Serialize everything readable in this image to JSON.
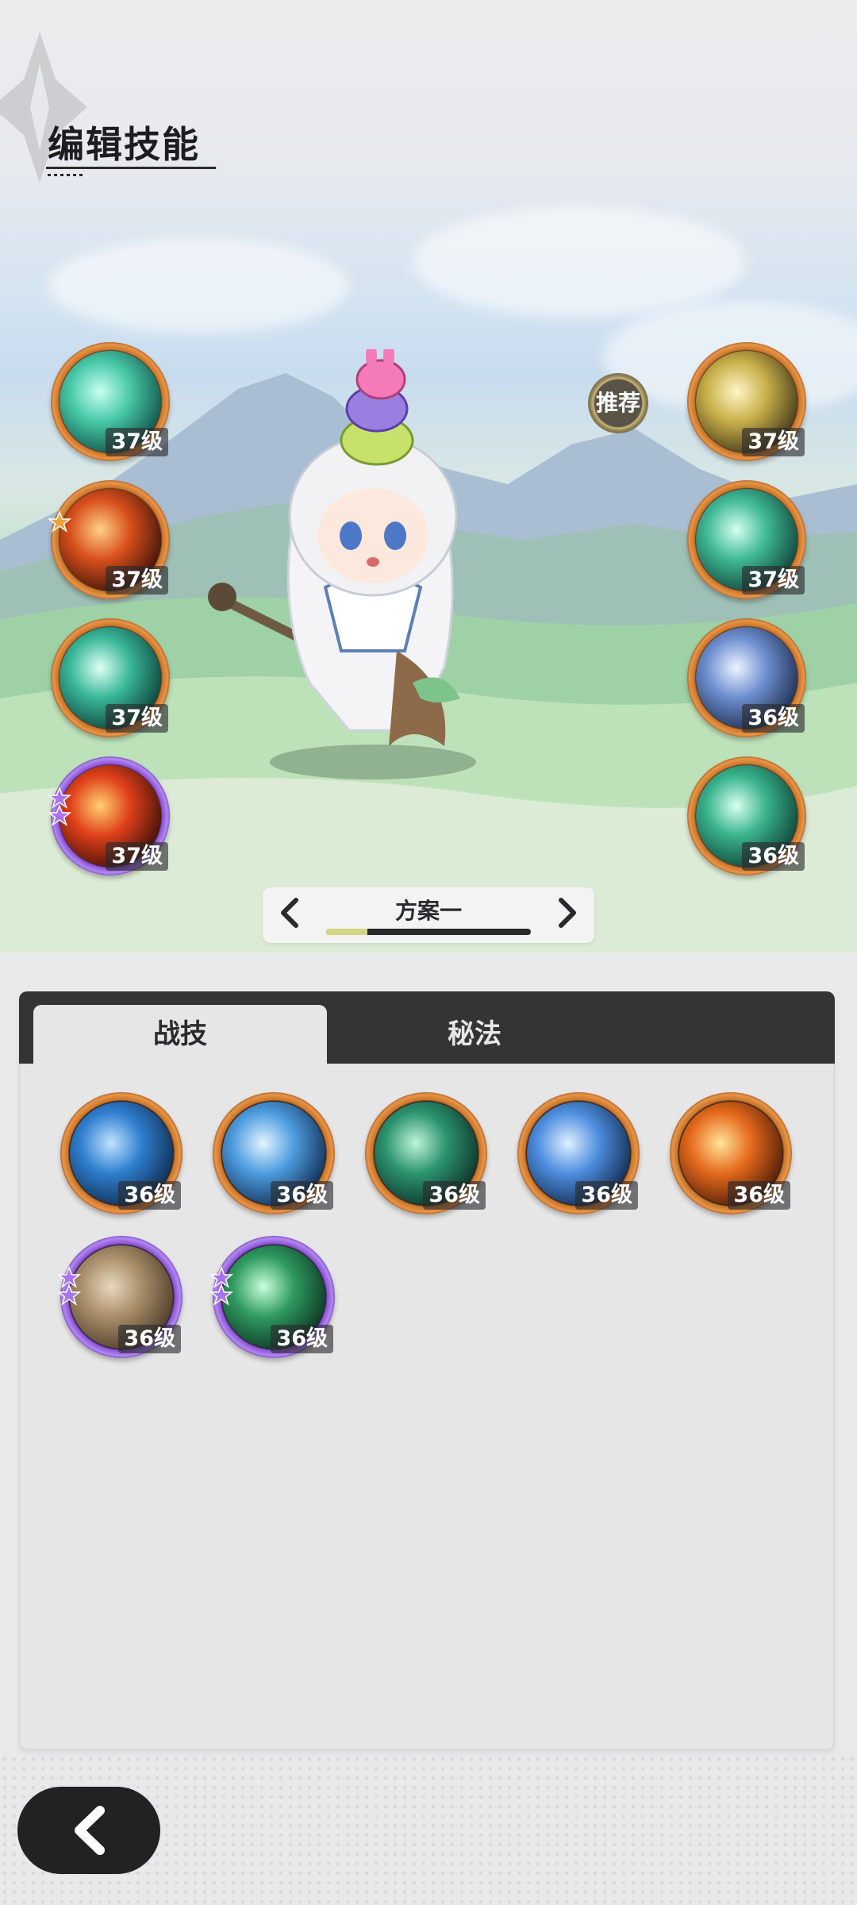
{
  "header": {
    "title": "编辑技能"
  },
  "left_skills": [
    {
      "icon": "wind-swirl-icon",
      "level": "37级",
      "rarity": "orange",
      "stars": 0
    },
    {
      "icon": "fire-ring-icon",
      "level": "37级",
      "rarity": "orange",
      "stars": 1
    },
    {
      "icon": "wind-slash-icon",
      "level": "37级",
      "rarity": "orange",
      "stars": 0
    },
    {
      "icon": "flame-burst-icon",
      "level": "37级",
      "rarity": "purple",
      "stars": 2
    }
  ],
  "right_skills": [
    {
      "icon": "light-arrow-up-icon",
      "level": "37级",
      "rarity": "orange"
    },
    {
      "icon": "recycle-orb-icon",
      "level": "37级",
      "rarity": "orange"
    },
    {
      "icon": "star-sparkle-icon",
      "level": "36级",
      "rarity": "orange"
    },
    {
      "icon": "shield-icon",
      "level": "36级",
      "rarity": "orange"
    }
  ],
  "recommend_label": "推荐",
  "scheme": {
    "name": "方案一",
    "progress": 0.2
  },
  "tabs": [
    {
      "label": "战技",
      "active": true
    },
    {
      "label": "秘法",
      "active": false
    }
  ],
  "grid_skills": [
    {
      "icon": "water-wave-icon",
      "level": "36级",
      "rarity": "orange",
      "stars": 0
    },
    {
      "icon": "ice-splash-icon",
      "level": "36级",
      "rarity": "orange",
      "stars": 0
    },
    {
      "icon": "thorn-vine-icon",
      "level": "36级",
      "rarity": "orange",
      "stars": 0
    },
    {
      "icon": "ice-crystal-icon",
      "level": "36级",
      "rarity": "orange",
      "stars": 0
    },
    {
      "icon": "fireball-icon",
      "level": "36级",
      "rarity": "orange",
      "stars": 0
    },
    {
      "icon": "rock-card-icon",
      "level": "36级",
      "rarity": "purple",
      "stars": 2
    },
    {
      "icon": "heal-plus-icon",
      "level": "36级",
      "rarity": "purple",
      "stars": 2
    }
  ],
  "colors": {
    "orange_ring": "#e89546",
    "purple_ring": "#b288f0",
    "tabbar": "#343434",
    "level_badge": "#28282c"
  }
}
